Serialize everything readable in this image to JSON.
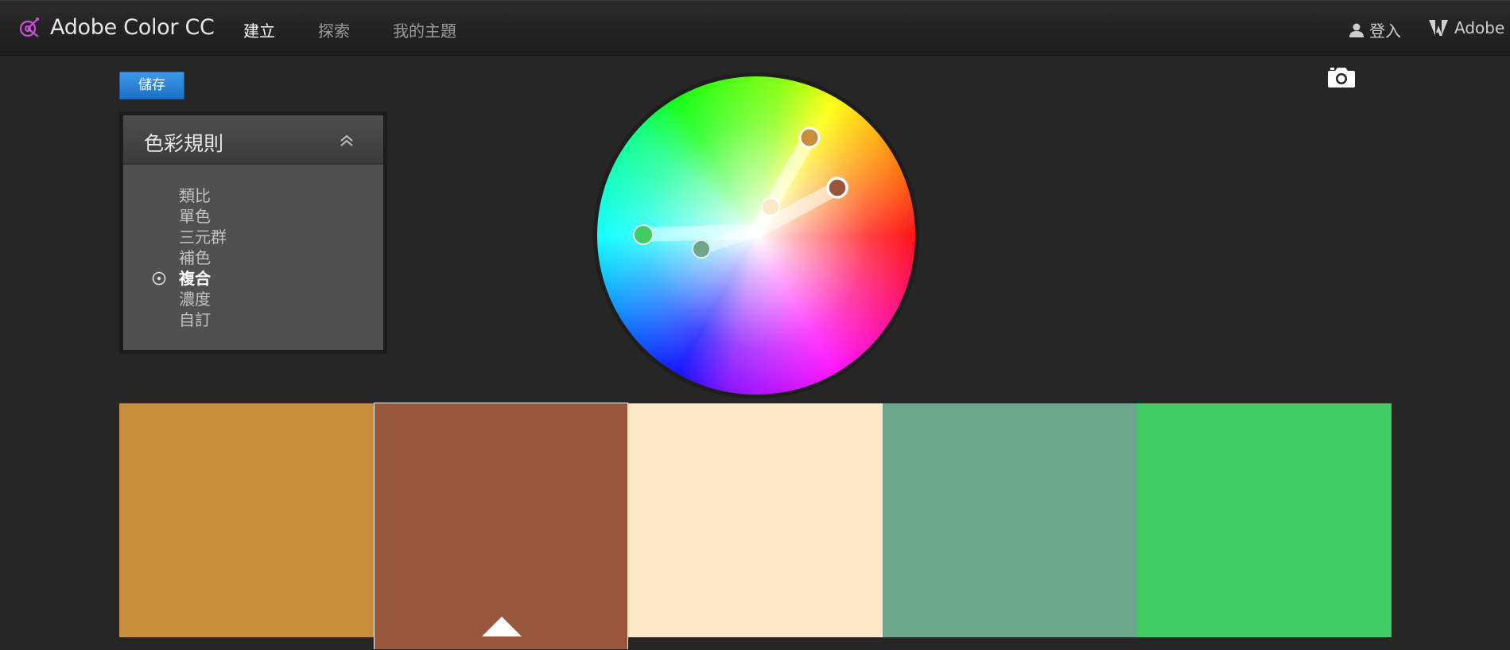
{
  "header": {
    "brand": "Adobe Color CC",
    "logo_icon": "adobe-color-logo-icon",
    "nav": [
      {
        "label": "建立",
        "active": true
      },
      {
        "label": "探索",
        "active": false
      },
      {
        "label": "我的主題",
        "active": false
      }
    ],
    "login_label": "登入",
    "adobe_label": "Adobe"
  },
  "toolbar": {
    "save_label": "儲存",
    "camera_icon": "camera-icon"
  },
  "rules_panel": {
    "title": "色彩規則",
    "collapse_icon": "double-chevron-up-icon",
    "items": [
      {
        "label": "類比",
        "selected": false
      },
      {
        "label": "單色",
        "selected": false
      },
      {
        "label": "三元群",
        "selected": false
      },
      {
        "label": "補色",
        "selected": false
      },
      {
        "label": "複合",
        "selected": true
      },
      {
        "label": "濃度",
        "selected": false
      },
      {
        "label": "自訂",
        "selected": false
      }
    ]
  },
  "palette": {
    "swatches": [
      {
        "color": "#C98E3C",
        "selected": false
      },
      {
        "color": "#98573D",
        "selected": true
      },
      {
        "color": "#FDE9C8",
        "selected": false
      },
      {
        "color": "#6CA68D",
        "selected": false
      },
      {
        "color": "#40CC63",
        "selected": false
      }
    ]
  },
  "colors": {
    "accent_blue": "#2A86DA",
    "background": "#262626"
  }
}
